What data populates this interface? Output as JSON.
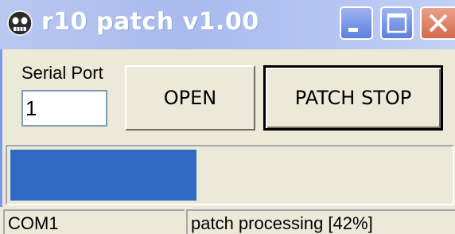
{
  "window": {
    "title": "r10 patch v1.00",
    "app_icon": "skull-icon",
    "controls": [
      "minimize-icon",
      "maximize-icon",
      "close-icon"
    ]
  },
  "serial": {
    "label": "Serial Port",
    "value": "1"
  },
  "buttons": {
    "open_label": "OPEN",
    "patch_stop_label": "PATCH STOP"
  },
  "progress": {
    "percent": 42
  },
  "status": {
    "port": "COM1",
    "message": "patch processing [42%]"
  },
  "colors": {
    "titlebar": "#a9bbee",
    "progress_fill": "#316ac5",
    "close_button": "#d46a4c",
    "face": "#ece9d8"
  }
}
